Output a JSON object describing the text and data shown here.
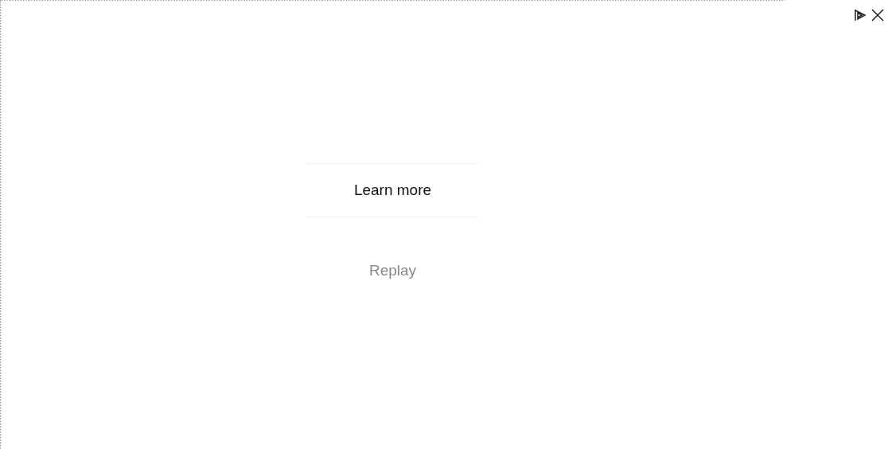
{
  "cta": {
    "label": "Learn more"
  },
  "replay": {
    "label": "Replay"
  }
}
